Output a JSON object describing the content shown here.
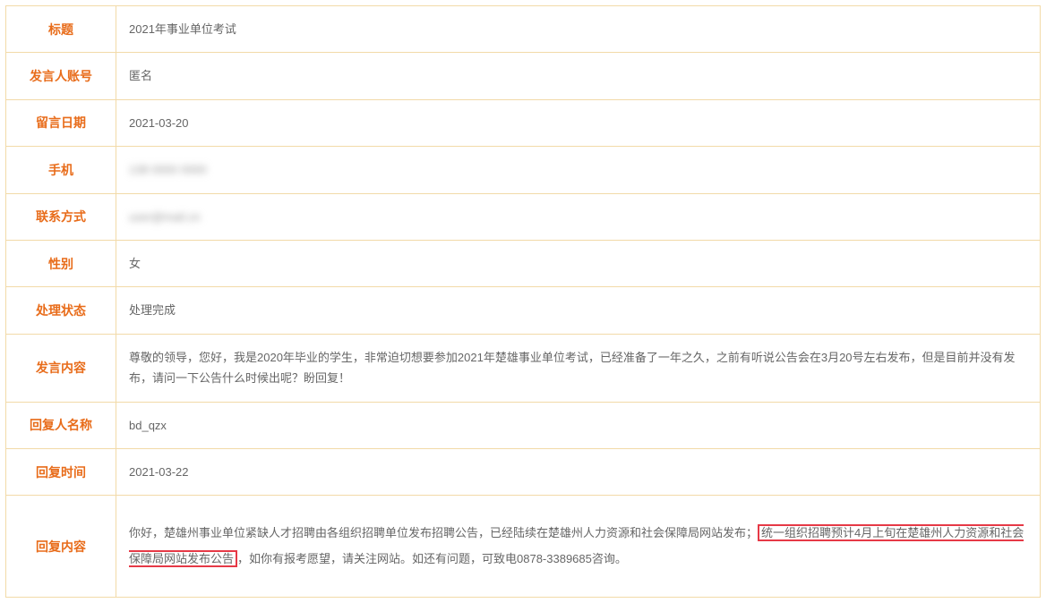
{
  "rows": {
    "title": {
      "label": "标题",
      "value": "2021年事业单位考试"
    },
    "account": {
      "label": "发言人账号",
      "value": "匿名"
    },
    "message_date": {
      "label": "留言日期",
      "value": "2021-03-20"
    },
    "phone": {
      "label": "手机",
      "value": "138 0000 0000"
    },
    "contact": {
      "label": "联系方式",
      "value": "user@mail.cn"
    },
    "gender": {
      "label": "性别",
      "value": "女"
    },
    "status": {
      "label": "处理状态",
      "value": "处理完成"
    },
    "content": {
      "label": "发言内容",
      "value": "尊敬的领导，您好，我是2020年毕业的学生，非常迫切想要参加2021年楚雄事业单位考试，已经准备了一年之久，之前有听说公告会在3月20号左右发布，但是目前并没有发布，请问一下公告什么时候出呢？盼回复！"
    },
    "reply_name": {
      "label": "回复人名称",
      "value": "bd_qzx"
    },
    "reply_time": {
      "label": "回复时间",
      "value": "2021-03-22"
    },
    "reply_content": {
      "label": "回复内容",
      "prefix": "你好，楚雄州事业单位紧缺人才招聘由各组织招聘单位发布招聘公告，已经陆续在楚雄州人力资源和社会保障局网站发布；",
      "highlight": "统一组织招聘预计4月上旬在楚雄州人力资源和社会保障局网站发布公告",
      "suffix": "，如你有报考愿望，请关注网站。如还有问题，可致电0878-3389685咨询。"
    }
  }
}
